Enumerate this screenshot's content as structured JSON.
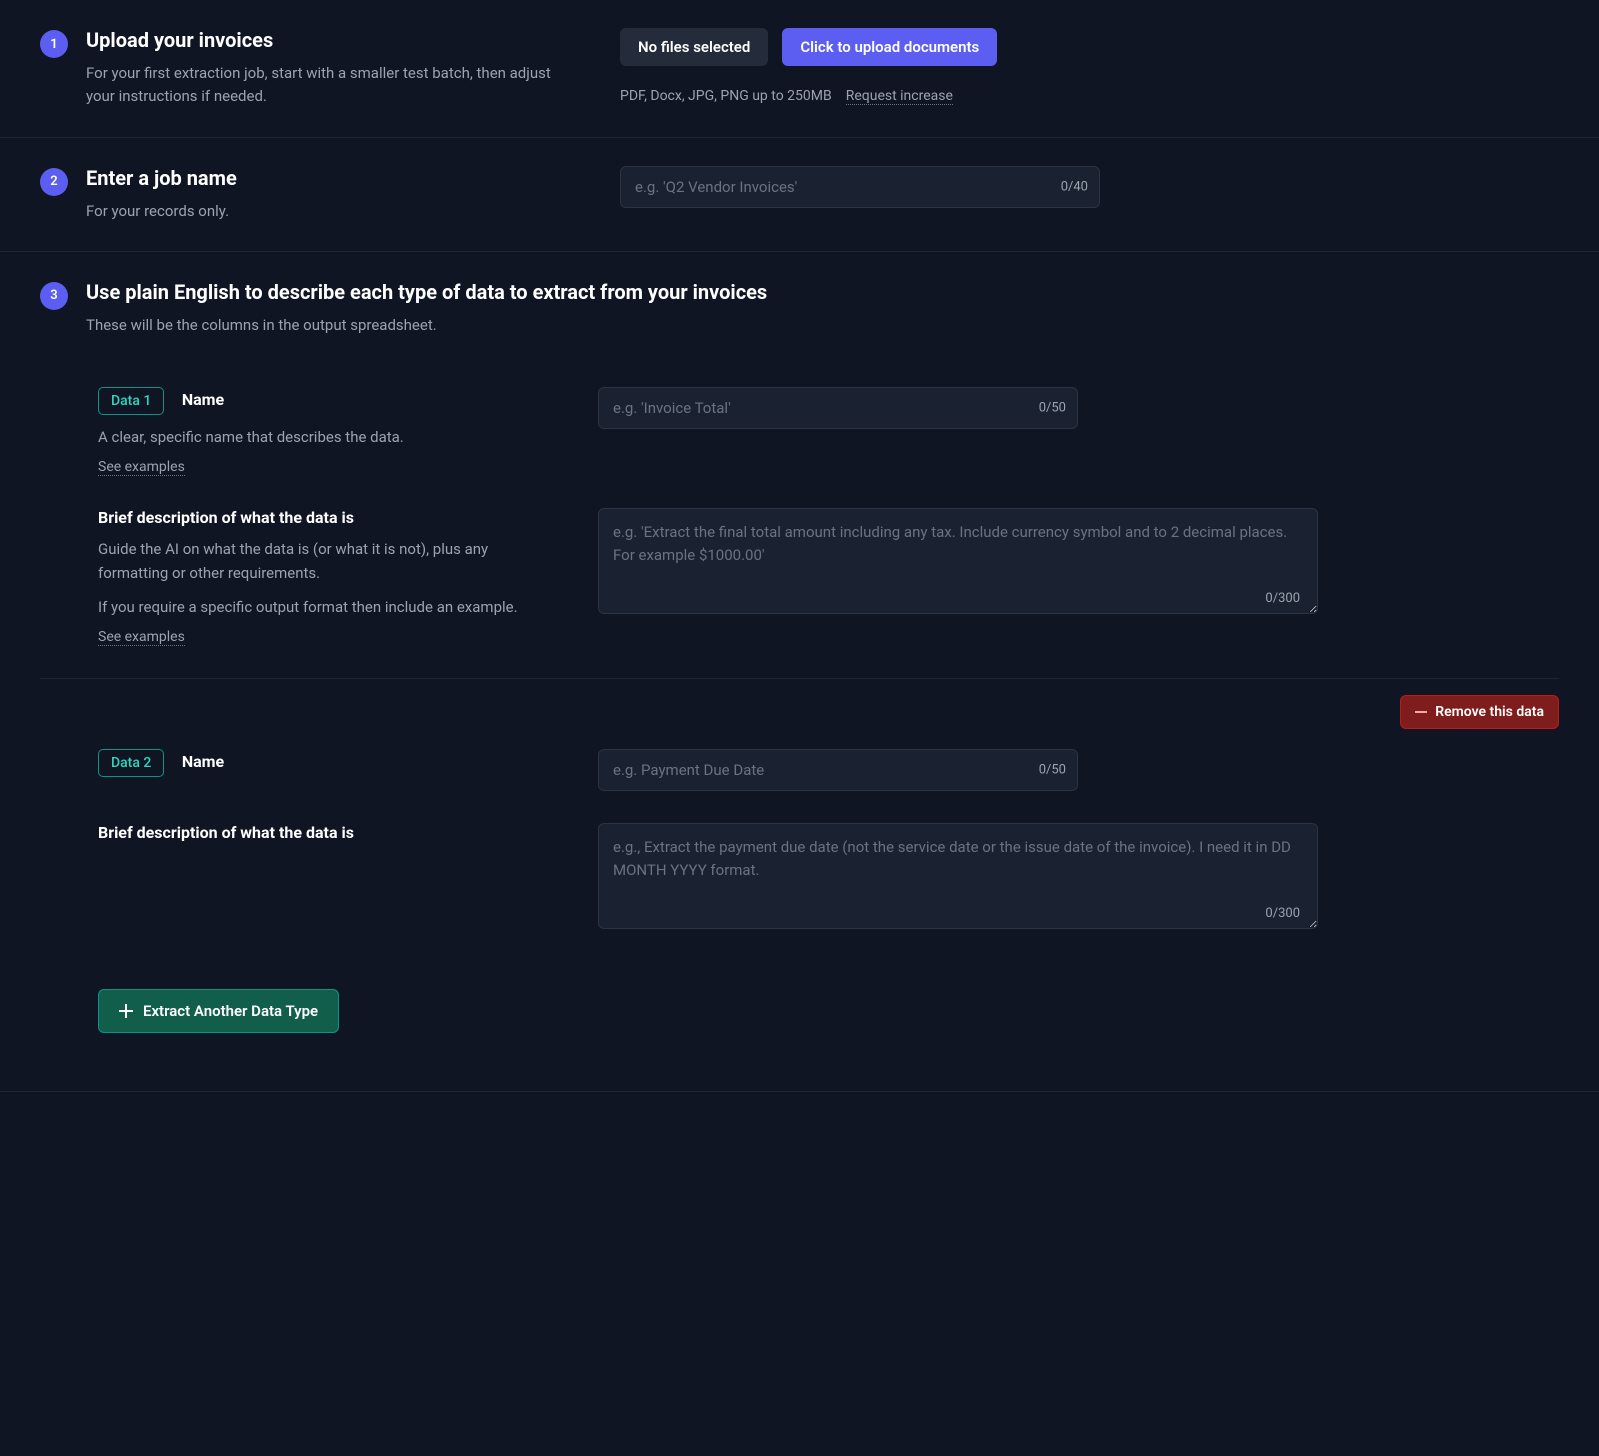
{
  "step1": {
    "number": "1",
    "title": "Upload your invoices",
    "desc": "For your first extraction job, start with a smaller test batch, then adjust your instructions if needed.",
    "no_files": "No files selected",
    "upload_btn": "Click to upload documents",
    "file_hint": "PDF, Docx, JPG, PNG up to 250MB",
    "request_increase": "Request increase"
  },
  "step2": {
    "number": "2",
    "title": "Enter a job name",
    "desc": "For your records only.",
    "placeholder": "e.g. 'Q2 Vendor Invoices'",
    "counter": "0/40"
  },
  "step3": {
    "number": "3",
    "title": "Use plain English to describe each type of data to extract from your invoices",
    "desc": "These will be the columns in the output spreadsheet."
  },
  "data1": {
    "tag": "Data 1",
    "name_label": "Name",
    "name_desc": "A clear, specific name that describes the data.",
    "see_examples": "See examples",
    "name_placeholder": "e.g. 'Invoice Total'",
    "name_counter": "0/50",
    "desc_label": "Brief description of what the data is",
    "desc_help1": "Guide the AI on what the data is (or what it is not), plus any formatting or other requirements.",
    "desc_help2": "If you require a specific output format then include an example.",
    "desc_placeholder": "e.g. 'Extract the final total amount including any tax. Include currency symbol and to 2 decimal places. For example $1000.00'",
    "desc_counter": "0/300"
  },
  "data2": {
    "tag": "Data 2",
    "name_label": "Name",
    "name_placeholder": "e.g. Payment Due Date",
    "name_counter": "0/50",
    "desc_label": "Brief description of what the data is",
    "desc_placeholder": "e.g., Extract the payment due date (not the service date or the issue date of the invoice). I need it in DD MONTH YYYY format.",
    "desc_counter": "0/300",
    "remove": "Remove this data"
  },
  "add_btn": "Extract Another Data Type"
}
